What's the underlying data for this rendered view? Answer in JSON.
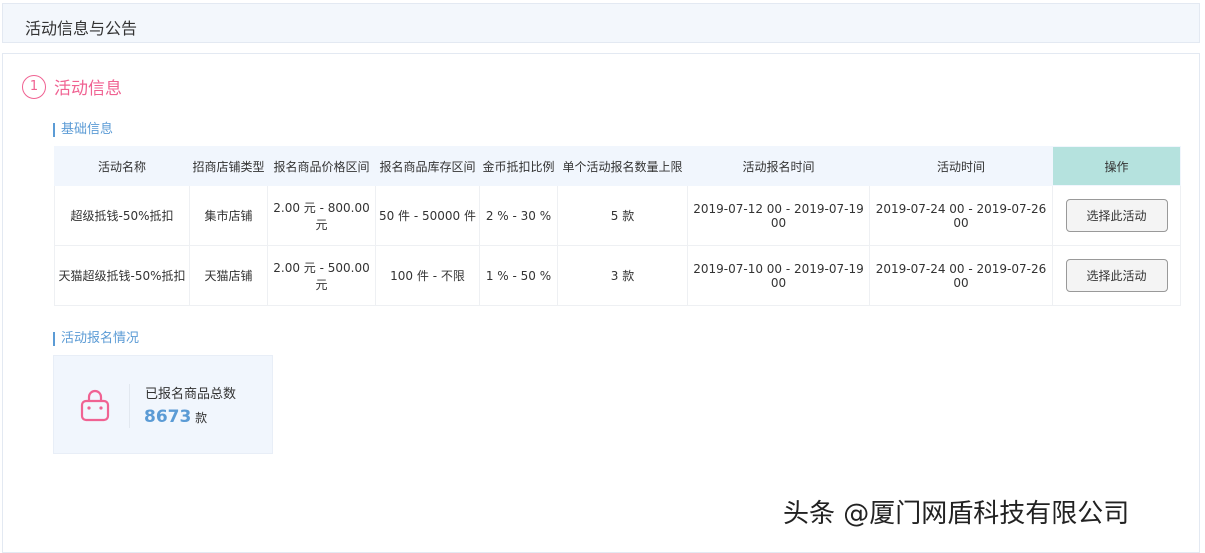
{
  "header": {
    "title": "活动信息与公告"
  },
  "section": {
    "number": "1",
    "title": "活动信息"
  },
  "basic": {
    "title": "基础信息",
    "columns": [
      "活动名称",
      "招商店铺类型",
      "报名商品价格区间",
      "报名商品库存区间",
      "金币抵扣比例",
      "单个活动报名数量上限",
      "活动报名时间",
      "活动时间",
      "操作"
    ],
    "rows": [
      [
        "超级抵钱-50%抵扣",
        "集市店铺",
        "2.00 元 - 800.00元",
        "50 件 - 50000 件",
        "2 % - 30 %",
        "5 款",
        "2019-07-12 00 - 2019-07-19 00",
        "2019-07-24 00 - 2019-07-26 00",
        "选择此活动"
      ],
      [
        "天猫超级抵钱-50%抵扣",
        "天猫店铺",
        "2.00 元 - 500.00元",
        "100 件 - 不限",
        "1 % - 50 %",
        "3 款",
        "2019-07-10 00 - 2019-07-19 00",
        "2019-07-24 00 - 2019-07-26 00",
        "选择此活动"
      ]
    ]
  },
  "signup": {
    "title": "活动报名情况",
    "label": "已报名商品总数",
    "value": "8673",
    "unit": "款"
  },
  "watermark": "头条 @厦门网盾科技有限公司"
}
